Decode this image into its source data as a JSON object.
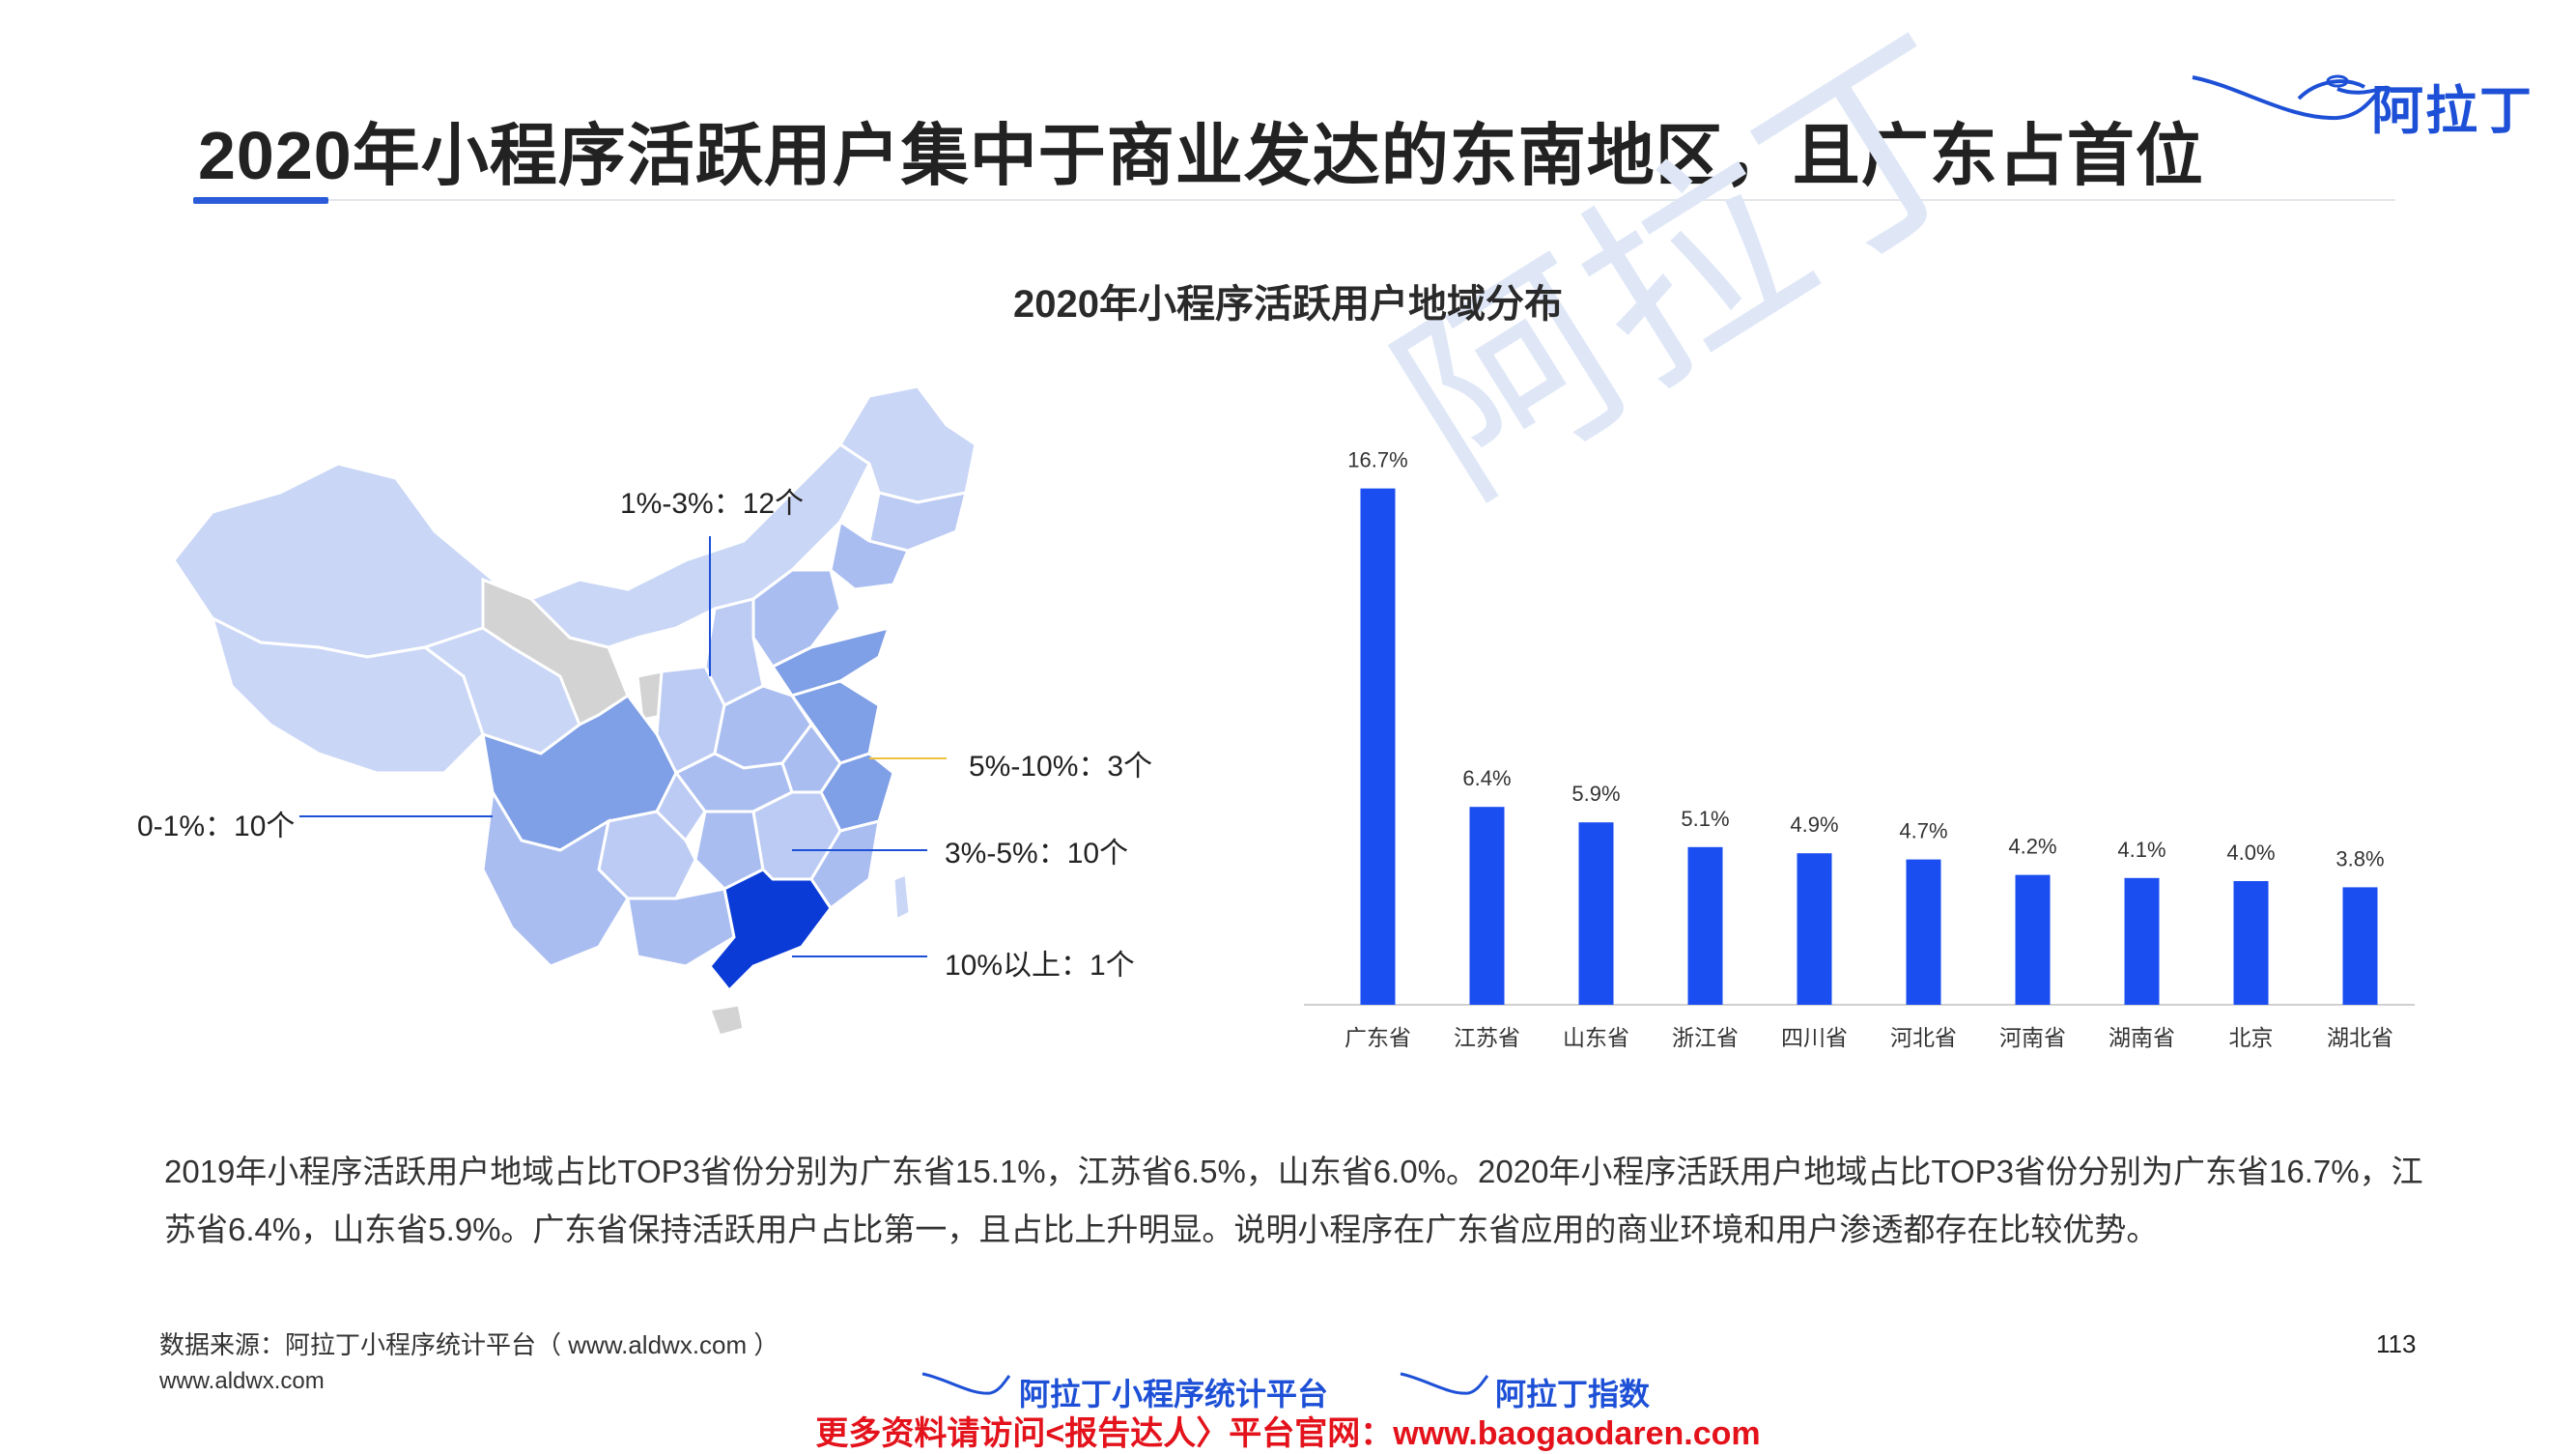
{
  "page": {
    "title": "2020年小程序活跃用户集中于商业发达的东南地区，且广东占首位",
    "logo_text": "阿拉丁",
    "watermark": "阿拉丁"
  },
  "legend": {
    "range_1_3": "1%-3%：12个",
    "range_5_10": "5%-10%：3个",
    "range_0_1": "0-1%：10个",
    "range_3_5": "3%-5%：10个",
    "range_10_plus": "10%以上：1个"
  },
  "chart_data": {
    "type": "bar",
    "title": "2020年小程序活跃用户地域分布",
    "categories": [
      "广东省",
      "江苏省",
      "山东省",
      "浙江省",
      "四川省",
      "河北省",
      "河南省",
      "湖南省",
      "北京",
      "湖北省"
    ],
    "values": [
      16.7,
      6.4,
      5.9,
      5.1,
      4.9,
      4.7,
      4.2,
      4.1,
      4.0,
      3.8
    ],
    "value_labels": [
      "16.7%",
      "6.4%",
      "5.9%",
      "5.1%",
      "4.9%",
      "4.7%",
      "4.2%",
      "4.1%",
      "4.0%",
      "3.8%"
    ],
    "ylim": [
      0,
      17.5
    ],
    "bar_color": "#1a4ef0",
    "grid": false
  },
  "description": "2019年小程序活跃用户地域占比TOP3省份分别为广东省15.1%，江苏省6.5%，山东省6.0%。2020年小程序活跃用户地域占比TOP3省份分别为广东省16.7%，江苏省6.4%，山东省5.9%。广东省保持活跃用户占比第一，且占比上升明显。说明小程序在广东省应用的商业环境和用户渗透都存在比较优势。",
  "footer": {
    "source": "数据来源：阿拉丁小程序统计平台（ www.aldwx.com ）",
    "site": "www.aldwx.com",
    "page_number": "113",
    "brand_1": "阿拉丁小程序统计平台",
    "brand_2": "阿拉丁指数",
    "promo": "更多资料请访问<报告达人〉平台官网：www.baogaodaren.com"
  },
  "colors": {
    "accent": "#2b5bd8",
    "map_light": "#c9d6f6",
    "map_mid": "#a9bdf0",
    "map_dark": "#7f9fe6",
    "map_top": "#0a3bd6",
    "map_gray": "#d3d3d3",
    "promo_red": "#e3121b"
  }
}
